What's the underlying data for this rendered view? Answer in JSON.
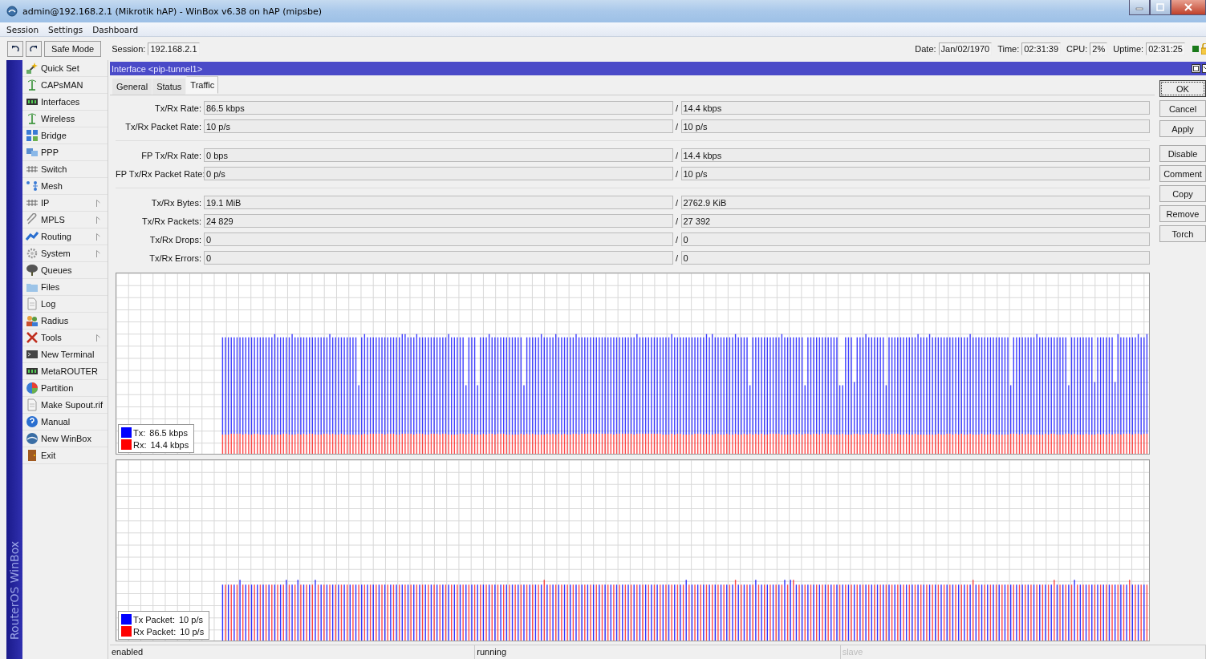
{
  "window": {
    "title": "admin@192.168.2.1 (Mikrotik hAP) - WinBox v6.38 on hAP (mipsbe)"
  },
  "menu": [
    "Session",
    "Settings",
    "Dashboard"
  ],
  "toolbar": {
    "safe_mode": "Safe Mode",
    "session_label": "Session:",
    "session_value": "192.168.2.1",
    "stats": [
      {
        "label": "Date:",
        "value": "Jan/02/1970"
      },
      {
        "label": "Time:",
        "value": "02:31:39"
      },
      {
        "label": "CPU:",
        "value": "2%"
      },
      {
        "label": "Uptime:",
        "value": "02:31:25"
      }
    ]
  },
  "side_label": "RouterOS WinBox",
  "sidebar": {
    "items": [
      {
        "label": "Quick Set",
        "submenu": false
      },
      {
        "label": "CAPsMAN",
        "submenu": false
      },
      {
        "label": "Interfaces",
        "submenu": false
      },
      {
        "label": "Wireless",
        "submenu": false
      },
      {
        "label": "Bridge",
        "submenu": false
      },
      {
        "label": "PPP",
        "submenu": false
      },
      {
        "label": "Switch",
        "submenu": false
      },
      {
        "label": "Mesh",
        "submenu": false
      },
      {
        "label": "IP",
        "submenu": true
      },
      {
        "label": "MPLS",
        "submenu": true
      },
      {
        "label": "Routing",
        "submenu": true
      },
      {
        "label": "System",
        "submenu": true
      },
      {
        "label": "Queues",
        "submenu": false
      },
      {
        "label": "Files",
        "submenu": false
      },
      {
        "label": "Log",
        "submenu": false
      },
      {
        "label": "Radius",
        "submenu": false
      },
      {
        "label": "Tools",
        "submenu": true
      },
      {
        "label": "New Terminal",
        "submenu": false
      },
      {
        "label": "MetaROUTER",
        "submenu": false
      },
      {
        "label": "Partition",
        "submenu": false
      },
      {
        "label": "Make Supout.rif",
        "submenu": false
      },
      {
        "label": "Manual",
        "submenu": false
      },
      {
        "label": "New WinBox",
        "submenu": false
      },
      {
        "label": "Exit",
        "submenu": false
      }
    ]
  },
  "dialog": {
    "title": "Interface <pip-tunnel1>",
    "tabs": [
      {
        "label": "General",
        "selected": false
      },
      {
        "label": "Status",
        "selected": false
      },
      {
        "label": "Traffic",
        "selected": true
      }
    ],
    "field_groups": [
      [
        {
          "label": "Tx/Rx Rate:",
          "tx": "86.5 kbps",
          "rx": "14.4 kbps"
        },
        {
          "label": "Tx/Rx Packet Rate:",
          "tx": "10 p/s",
          "rx": "10 p/s"
        }
      ],
      [
        {
          "label": "FP Tx/Rx Rate:",
          "tx": "0 bps",
          "rx": "14.4 kbps"
        },
        {
          "label": "FP Tx/Rx Packet Rate:",
          "tx": "0 p/s",
          "rx": "10 p/s"
        }
      ],
      [
        {
          "label": "Tx/Rx Bytes:",
          "tx": "19.1 MiB",
          "rx": "2762.9 KiB"
        },
        {
          "label": "Tx/Rx Packets:",
          "tx": "24 829",
          "rx": "27 392"
        },
        {
          "label": "Tx/Rx Drops:",
          "tx": "0",
          "rx": "0"
        },
        {
          "label": "Tx/Rx Errors:",
          "tx": "0",
          "rx": "0"
        }
      ]
    ],
    "separator": "/",
    "graphs": [
      {
        "kind": "bytes",
        "legend": [
          {
            "label": "Tx:",
            "value": "86.5 kbps",
            "color": "#0000ff"
          },
          {
            "label": "Rx:",
            "value": "14.4 kbps",
            "color": "#ff0000"
          }
        ]
      },
      {
        "kind": "packets",
        "legend": [
          {
            "label": "Tx Packet:",
            "value": "10 p/s",
            "color": "#0000ff"
          },
          {
            "label": "Rx Packet:",
            "value": "10 p/s",
            "color": "#ff0000"
          }
        ]
      }
    ],
    "buttons": [
      {
        "label": "OK",
        "focused": true
      },
      {
        "label": "Cancel",
        "focused": false
      },
      {
        "label": "Apply",
        "focused": false
      },
      {
        "label": "Disable",
        "focused": false
      },
      {
        "label": "Comment",
        "focused": false
      },
      {
        "label": "Copy",
        "focused": false
      },
      {
        "label": "Remove",
        "focused": false
      },
      {
        "label": "Torch",
        "focused": false
      }
    ],
    "status_bar": [
      {
        "text": "enabled",
        "disabled": false
      },
      {
        "text": "running",
        "disabled": false
      },
      {
        "text": "slave",
        "disabled": true
      }
    ]
  }
}
